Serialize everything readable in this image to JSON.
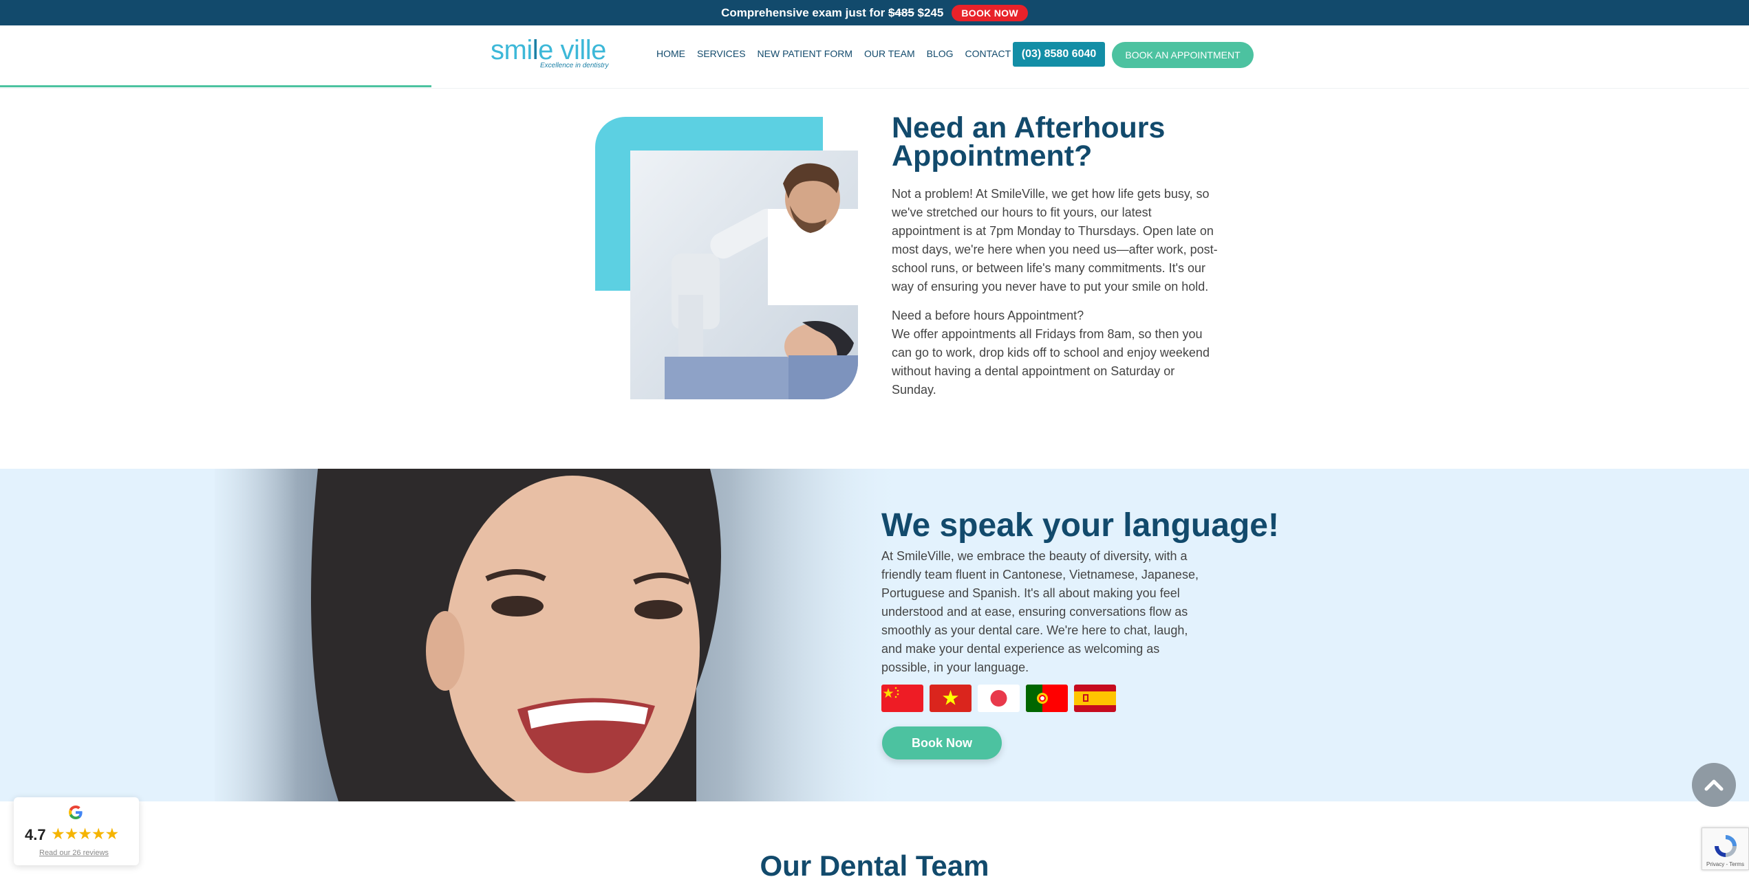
{
  "promo": {
    "text": "Comprehensive exam just for",
    "old_price": "$485",
    "new_price": "$245",
    "button": "BOOK NOW"
  },
  "header": {
    "logo_main_a": "smi",
    "logo_main_b": "l",
    "logo_main_c": "e ville",
    "logo_tagline": "Excellence in dentistry",
    "nav": [
      "HOME",
      "SERVICES",
      "NEW PATIENT FORM",
      "OUR TEAM",
      "BLOG",
      "CONTACT US"
    ],
    "phone": "(03) 8580 6040",
    "book_button": "BOOK AN APPOINTMENT"
  },
  "afterhours": {
    "title": "Need an Afterhours Appointment?",
    "paragraph1": "Not a problem! At SmileVille, we get how life gets busy, so we've stretched our hours to fit yours, our latest appointment is at 7pm Monday to Thursdays. Open late on most days, we're here when you need us—after work, post-school runs, or between life's many commitments. It's our way of ensuring you never have to put your smile on hold.",
    "paragraph2_heading": "Need a before hours Appointment?",
    "paragraph2": "We offer appointments all Fridays from 8am, so then you can go to work, drop kids off to school and enjoy weekend without having a dental appointment on Saturday or Sunday."
  },
  "languages": {
    "title": "We speak your language!",
    "text": "At SmileVille, we embrace the beauty of diversity, with a friendly team fluent in Cantonese, Vietnamese, Japanese, Portuguese and Spanish. It's all about making you feel understood and at ease, ensuring conversations flow as smoothly as your dental care. We're here to chat, laugh, and make your dental experience as welcoming as possible, in your language.",
    "flags": [
      "china-flag",
      "vietnam-flag",
      "japan-flag",
      "portugal-flag",
      "spain-flag"
    ],
    "button": "Book Now"
  },
  "team": {
    "title": "Our Dental Team"
  },
  "reviews": {
    "rating": "4.7",
    "stars": "★★★★★",
    "link": "Read our 26 reviews"
  },
  "recaptcha": {
    "text": "Privacy - Terms"
  },
  "colors": {
    "navy": "#124a6c",
    "teal_button": "#138ea6",
    "green_button": "#4cc2a0",
    "cyan_block": "#5cd0e2",
    "promo_red": "#e8222a",
    "light_blue_bg": "#e3f2fd"
  }
}
